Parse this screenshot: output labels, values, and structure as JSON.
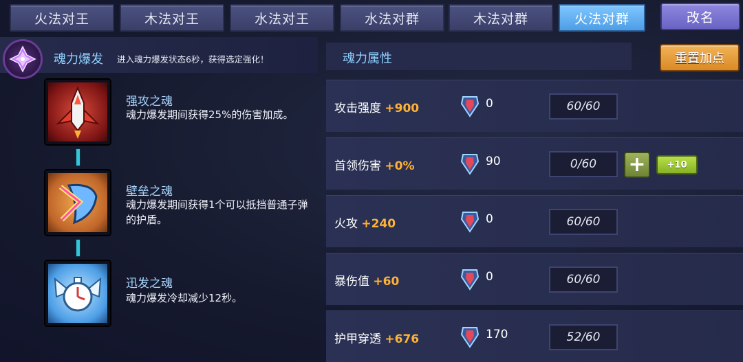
{
  "tabs": [
    {
      "label": "火法对王",
      "active": false
    },
    {
      "label": "木法对王",
      "active": false
    },
    {
      "label": "水法对王",
      "active": false
    },
    {
      "label": "水法对群",
      "active": false
    },
    {
      "label": "木法对群",
      "active": false
    },
    {
      "label": "火法对群",
      "active": true
    }
  ],
  "rename_label": "改名",
  "burst": {
    "title": "魂力爆发",
    "description": "进入魂力爆发状态6秒，获得选定强化！"
  },
  "souls": [
    {
      "name": "强攻之魂",
      "description": "魂力爆发期间获得25%的伤害加成。",
      "icon": "red-rocket-icon"
    },
    {
      "name": "壁垒之魂",
      "description": "魂力爆发期间获得1个可以抵挡普通子弹的护盾。",
      "icon": "shield-sword-icon"
    },
    {
      "name": "迅发之魂",
      "description": "魂力爆发冷却减少12秒。",
      "icon": "winged-clock-icon"
    }
  ],
  "attributes_header": "魂力属性",
  "reset_label": "重置加点",
  "attributes": [
    {
      "name": "攻击强度",
      "bonus": "+900",
      "gems": "0",
      "level": "60/60"
    },
    {
      "name": "首领伤害",
      "bonus": "+0%",
      "gems": "90",
      "level": "0/60",
      "plus_label": "+",
      "plus10_label": "+10"
    },
    {
      "name": "火攻",
      "bonus": "+240",
      "gems": "0",
      "level": "60/60"
    },
    {
      "name": "暴伤值",
      "bonus": "+60",
      "gems": "0",
      "level": "60/60"
    },
    {
      "name": "护甲穿透",
      "bonus": "+676",
      "gems": "170",
      "level": "52/60"
    }
  ],
  "colors": {
    "bonus": "#ffb236",
    "active_tab": "#5cadf0",
    "accent_title": "#8fd2ff",
    "reset_button": "#e59a34",
    "plus_button": "#86b224"
  }
}
